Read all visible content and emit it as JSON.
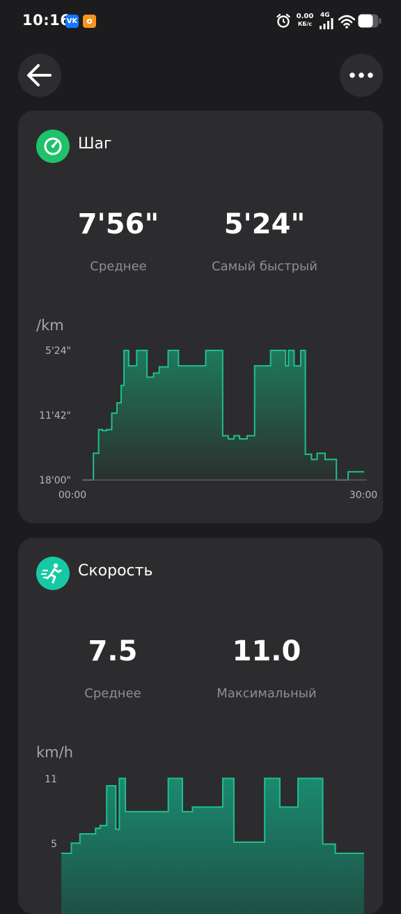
{
  "status_bar": {
    "time": "10:16",
    "apps": [
      "VK",
      "OK"
    ],
    "net_speed_value": "0.00",
    "net_speed_unit": "КБ/с",
    "network": "4G",
    "icons": [
      "alarm-icon",
      "signal-icon",
      "wifi-icon",
      "battery-icon"
    ]
  },
  "header": {
    "back_icon": "arrow-left-icon",
    "more_icon": "more-dots-icon"
  },
  "colors": {
    "background": "#1c1c1e",
    "card": "#2c2c2e",
    "pace_icon": "#1fc26b",
    "speed_icon": "#17c9a3",
    "chart_line": "#1fbf8f",
    "chart_fill_top": "#1e7a5c",
    "chart_fill_bottom": "#2b2f2d"
  },
  "pace": {
    "title": "Шаг",
    "icon": "speedometer-icon",
    "average_value": "7'56\"",
    "average_label": "Среднее",
    "fastest_value": "5'24\"",
    "fastest_label": "Самый быстрый",
    "unit": "/km",
    "chart_data": {
      "type": "area",
      "y_tick_labels": [
        "5'24\"",
        "11'42\"",
        "18'00\""
      ],
      "x_tick_labels": [
        "00:00",
        "30:00"
      ],
      "xlim": [
        0,
        30
      ],
      "ylim": [
        324,
        1080
      ],
      "y_inverted": true,
      "x": [
        0,
        0.85,
        1.2,
        1.75,
        2.15,
        2.6,
        3.15,
        3.7,
        4.15,
        4.45,
        4.95,
        5.8,
        6.9,
        7.6,
        8.2,
        9.15,
        10.25,
        11.75,
        13.15,
        14.95,
        15.55,
        16.15,
        16.75,
        17.55,
        18.35,
        20.05,
        21.65,
        21.95,
        22.55,
        23.25,
        23.75,
        24.4,
        25.0,
        25.85,
        27.05,
        28.3
      ],
      "y": [
        1080,
        1080,
        924,
        786,
        792,
        786,
        690,
        630,
        528,
        324,
        414,
        324,
        480,
        456,
        420,
        324,
        414,
        414,
        324,
        822,
        840,
        822,
        840,
        822,
        414,
        324,
        414,
        324,
        414,
        324,
        930,
        960,
        924,
        960,
        1080,
        1032
      ]
    }
  },
  "speed": {
    "title": "Скорость",
    "icon": "running-person-icon",
    "average_value": "7.5",
    "average_label": "Среднее",
    "max_value": "11.0",
    "max_label": "Максимальный",
    "unit": "km/h",
    "chart_data": {
      "type": "area",
      "y_tick_labels": [
        "11",
        "5"
      ],
      "x_tick_labels": [],
      "xlim": [
        0,
        30
      ],
      "ylim": [
        0,
        11
      ],
      "x": [
        0,
        1.0,
        1.85,
        3.4,
        3.85,
        4.5,
        5.4,
        5.75,
        6.35,
        7.95,
        10.6,
        12.0,
        13.0,
        16.0,
        17.1,
        20.15,
        21.65,
        23.45,
        25.9,
        27.15
      ],
      "y": [
        2.8,
        3.9,
        4.9,
        5.5,
        5.8,
        10.1,
        5.4,
        10.9,
        7.3,
        7.3,
        10.9,
        7.3,
        7.8,
        10.9,
        4.0,
        10.9,
        7.8,
        10.9,
        3.8,
        2.8
      ]
    }
  }
}
